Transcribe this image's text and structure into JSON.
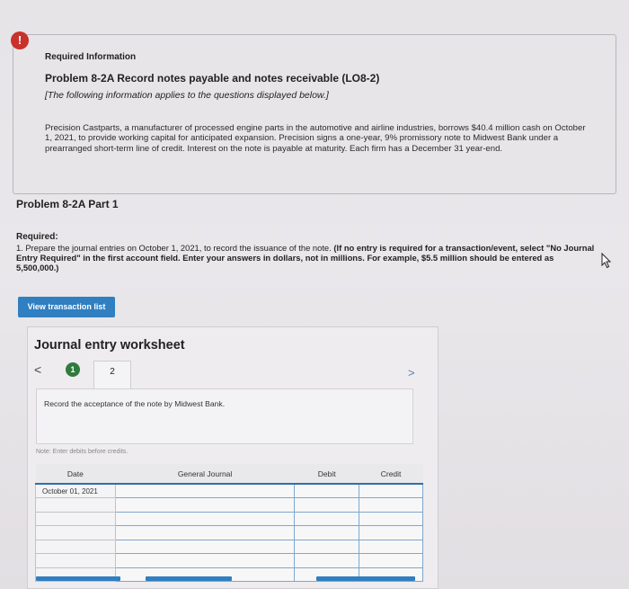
{
  "alert": {
    "symbol": "!"
  },
  "header": {
    "required_info": "Required Information",
    "problem_title": "Problem 8-2A Record notes payable and notes receivable (LO8-2)",
    "italic_note": "[The following information applies to the questions displayed below.]",
    "description": "Precision Castparts, a manufacturer of processed engine parts in the automotive and airline industries, borrows $40.4 million cash on October 1, 2021, to provide working capital for anticipated expansion. Precision signs a one-year, 9% promissory note to Midwest Bank under a prearranged short-term line of credit. Interest on the note is payable at maturity. Each firm has a December 31 year-end."
  },
  "part": {
    "title": "Problem 8-2A Part 1",
    "required_label": "Required:",
    "required_text": "1. Prepare the journal entries on October 1, 2021, to record the issuance of the note.",
    "required_bold": "(If no entry is required for a transaction/event, select \"No Journal Entry Required\" in the first account field. Enter your answers in dollars, not in millions. For example, $5.5 million should be entered as 5,500,000.)"
  },
  "view_button": "View transaction list",
  "worksheet": {
    "title": "Journal entry worksheet",
    "prev": "<",
    "next": ">",
    "step1": "1",
    "step2": "2",
    "instruction": "Record the acceptance of the note by Midwest Bank.",
    "note": "Note: Enter debits before credits.",
    "columns": {
      "date": "Date",
      "account": "General Journal",
      "debit": "Debit",
      "credit": "Credit"
    },
    "first_date": "October 01, 2021"
  }
}
